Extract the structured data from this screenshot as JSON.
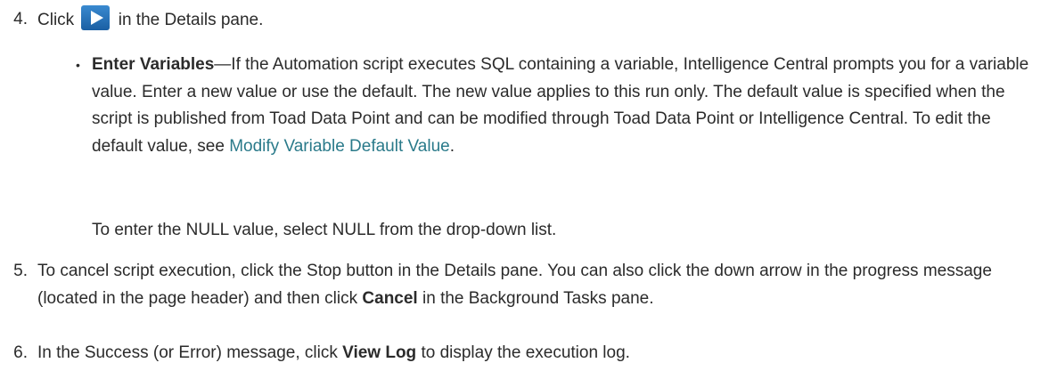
{
  "step4": {
    "number": "4.",
    "before": "Click",
    "after": "in the Details pane."
  },
  "bullet": {
    "term": "Enter Variables",
    "text": "—If the Automation script executes SQL containing a variable, Intelligence Central prompts you for a variable value. Enter a new value or use the default. The new value applies to this run only. The default value is specified when the script is published from Toad Data Point and can be modified through Toad Data Point or Intelligence Central. To edit the default value, see ",
    "link": "Modify Variable Default Value",
    "end": "."
  },
  "note": "To enter the NULL value, select NULL from the drop-down list.",
  "step5": {
    "number": "5.",
    "text_a": "To cancel script execution, click the Stop button in the Details pane. You can also click the down arrow in the progress message (located in the page header) and then click ",
    "bold": "Cancel",
    "text_b": " in the Background Tasks pane."
  },
  "step6": {
    "number": "6.",
    "text_a": "In the Success (or Error) message, click ",
    "bold": "View Log",
    "text_b": " to display the execution log."
  },
  "icons": {
    "play": "play-icon"
  },
  "colors": {
    "link": "#2a7a8a",
    "play_button": "#1f6fb8"
  }
}
